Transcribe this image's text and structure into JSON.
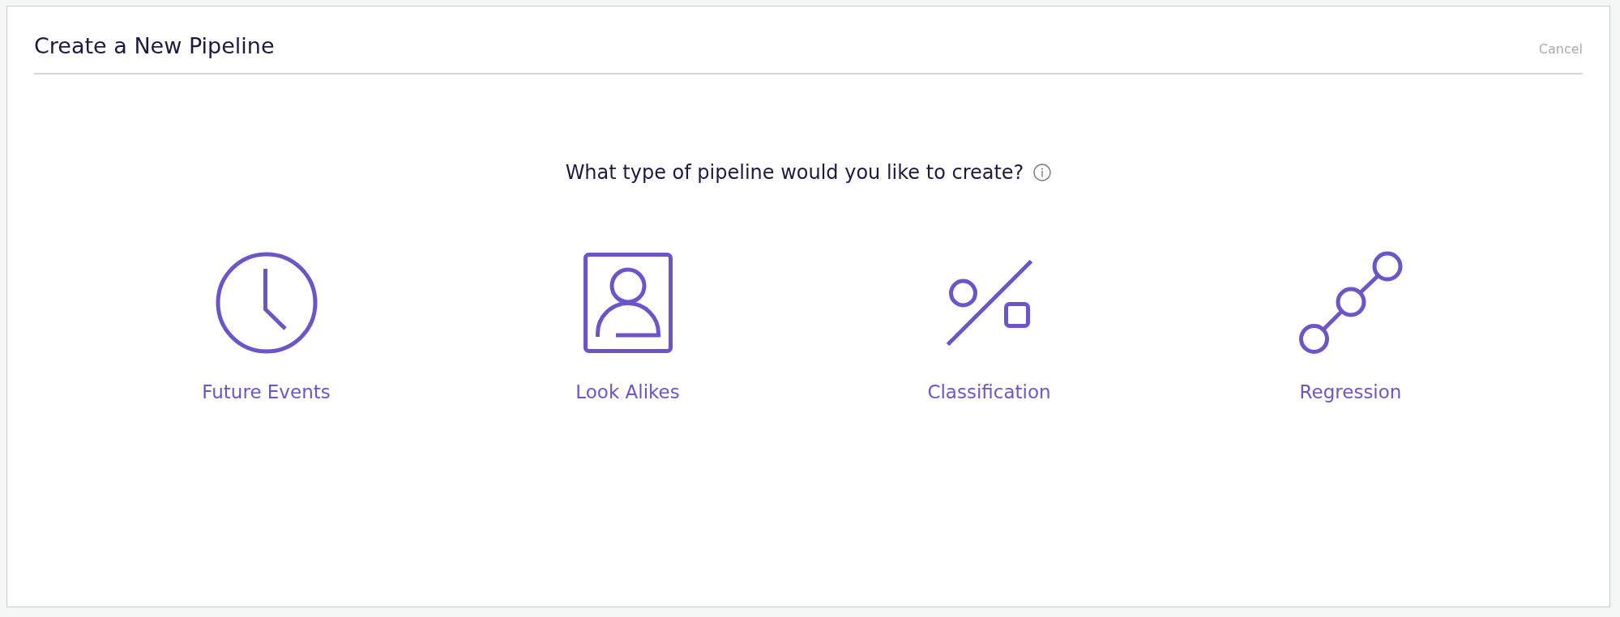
{
  "dialog": {
    "title": "Create a New Pipeline",
    "cancel": "Cancel"
  },
  "prompt": {
    "text": "What type of pipeline would you like to create?"
  },
  "options": [
    {
      "kind": "clock",
      "label": "Future Events"
    },
    {
      "kind": "portrait",
      "label": "Look Alikes"
    },
    {
      "kind": "classification",
      "label": "Classification"
    },
    {
      "kind": "regression",
      "label": "Regression"
    }
  ]
}
